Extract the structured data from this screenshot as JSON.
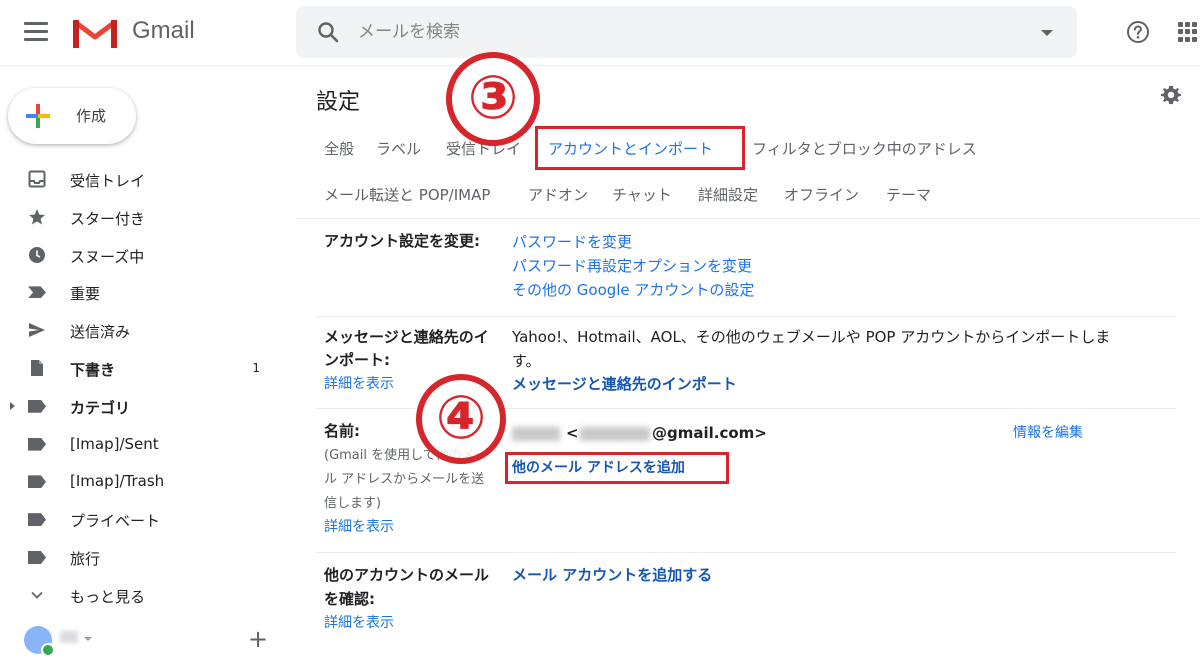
{
  "header": {
    "app_name": "Gmail",
    "search_placeholder": "メールを検索"
  },
  "sidebar": {
    "compose_label": "作成",
    "items": [
      {
        "label": "受信トレイ",
        "icon": "inbox-icon"
      },
      {
        "label": "スター付き",
        "icon": "star-icon"
      },
      {
        "label": "スヌーズ中",
        "icon": "clock-icon"
      },
      {
        "label": "重要",
        "icon": "important-icon"
      },
      {
        "label": "送信済み",
        "icon": "send-icon"
      },
      {
        "label": "下書き",
        "icon": "draft-icon",
        "count": "1"
      },
      {
        "label": "カテゴリ",
        "icon": "label-icon"
      },
      {
        "label": "[Imap]/Sent",
        "icon": "label-icon"
      },
      {
        "label": "[Imap]/Trash",
        "icon": "label-icon"
      },
      {
        "label": "プライベート",
        "icon": "label-icon"
      },
      {
        "label": "旅行",
        "icon": "label-icon"
      },
      {
        "label": "もっと見る",
        "icon": "chevron-down-icon"
      }
    ],
    "add_label": "+"
  },
  "settings": {
    "title": "設定",
    "tabs_row1": [
      "全般",
      "ラベル",
      "受信トレイ",
      "アカウントとインポート",
      "フィルタとブロック中のアドレス"
    ],
    "tabs_row2": [
      "メール転送と POP/IMAP",
      "アドオン",
      "チャット",
      "詳細設定",
      "オフライン",
      "テーマ"
    ],
    "active_tab": "アカウントとインポート",
    "sections": {
      "account": {
        "label": "アカウント設定を変更:",
        "links": [
          "パスワードを変更",
          "パスワード再設定オプションを変更",
          "その他の Google アカウントの設定"
        ]
      },
      "import": {
        "label_line1": "メッセージと連絡先のイ",
        "label_line2": "ンポート:",
        "details": "詳細を表示",
        "desc_line1": "Yahoo!、Hotmail、AOL、その他のウェブメールや POP アカウントからインポートしま",
        "desc_line2": "す。",
        "link": "メッセージと連絡先のインポート"
      },
      "name": {
        "label": "名前:",
        "sub_line1": "(Gmail を使用して他のメー",
        "sub_line2": "ル アドレスからメールを送",
        "sub_line3": "信します)",
        "details": "詳細を表示",
        "email_open": "<",
        "email_domain": "@gmail.com>",
        "edit_link": "情報を編集",
        "add_link": "他のメール アドレスを追加"
      },
      "check_mail": {
        "label_line1": "他のアカウントのメール",
        "label_line2": "を確認:",
        "details": "詳細を表示",
        "link": "メール アカウントを追加する"
      }
    },
    "annotations": [
      "③",
      "④"
    ]
  },
  "colors": {
    "accent_blue": "#1a73e8",
    "annotation_red": "#d6262b",
    "gmail_red": "#ea4335"
  }
}
